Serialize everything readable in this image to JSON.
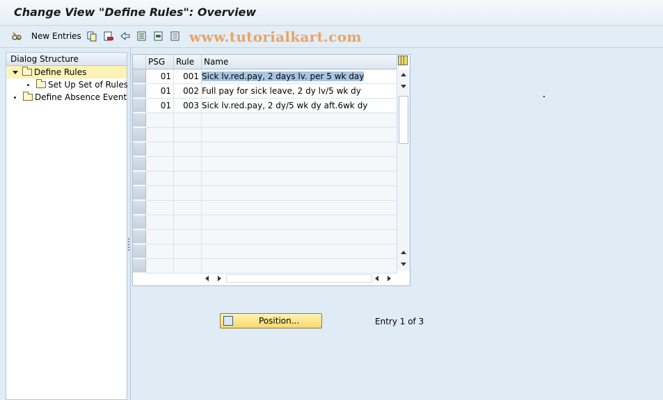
{
  "window": {
    "title": "Change View \"Define Rules\": Overview"
  },
  "toolbar": {
    "new_entries_label": "New Entries",
    "watermark": "www.tutorialkart.com",
    "icons": [
      "edit-glasses-icon",
      "copy-icon",
      "delete-icon",
      "undo-icon",
      "select-all-icon",
      "select-block-icon",
      "deselect-all-icon"
    ]
  },
  "dialog_structure": {
    "header": "Dialog Structure",
    "items": [
      {
        "label": "Define Rules",
        "selected": true,
        "expanded": true
      },
      {
        "label": "Set Up Set of Rules"
      },
      {
        "label": "Define Absence Event"
      }
    ]
  },
  "table": {
    "columns": [
      "PSG",
      "Rule",
      "Name"
    ],
    "rows": [
      {
        "psg": "01",
        "rule": "001",
        "name": "Sick lv.red.pay, 2 days lv. per 5 wk day"
      },
      {
        "psg": "01",
        "rule": "002",
        "name": "Full pay for sick leave, 2 dy lv/5 wk dy"
      },
      {
        "psg": "01",
        "rule": "003",
        "name": "Sick lv.red.pay, 2 dy/5 wk dy aft.6wk dy"
      }
    ],
    "empty_rows": 11
  },
  "footer": {
    "position_label": "Position...",
    "entry_text": "Entry 1 of 3"
  },
  "colors": {
    "background": "#dfebf5",
    "selected_tree_item": "#fbf3b5",
    "cell_highlight": "#a7c6e4",
    "position_button": "#f7d96a"
  }
}
